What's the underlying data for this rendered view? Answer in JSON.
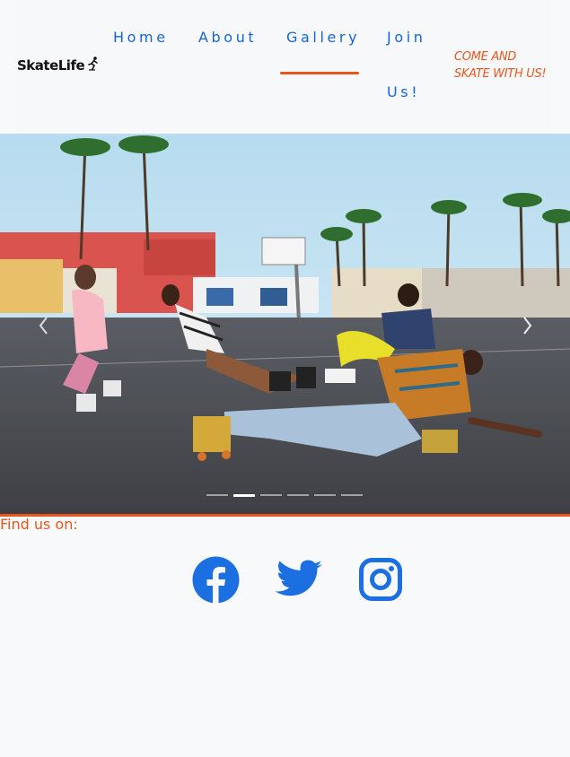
{
  "brand": {
    "name": "SkateLife"
  },
  "nav": {
    "items": [
      {
        "label": "Home"
      },
      {
        "label": "About"
      },
      {
        "label": "Gallery",
        "active": true
      },
      {
        "label": "Join"
      },
      {
        "label": "Us!"
      }
    ]
  },
  "cta": {
    "line1": "COME AND",
    "line2": "SKATE WITH US!"
  },
  "carousel": {
    "slide_count": 6,
    "active_index": 1,
    "prev_icon": "chevron-left-icon",
    "next_icon": "chevron-right-icon"
  },
  "footer": {
    "find_label": "Find us on:",
    "social": [
      {
        "name": "facebook-icon"
      },
      {
        "name": "twitter-icon"
      },
      {
        "name": "instagram-icon"
      }
    ]
  },
  "colors": {
    "nav_blue": "#1565d8",
    "accent_orange": "#e8561e",
    "social_blue": "#1c6fe0",
    "background": "#f8f9fa"
  }
}
